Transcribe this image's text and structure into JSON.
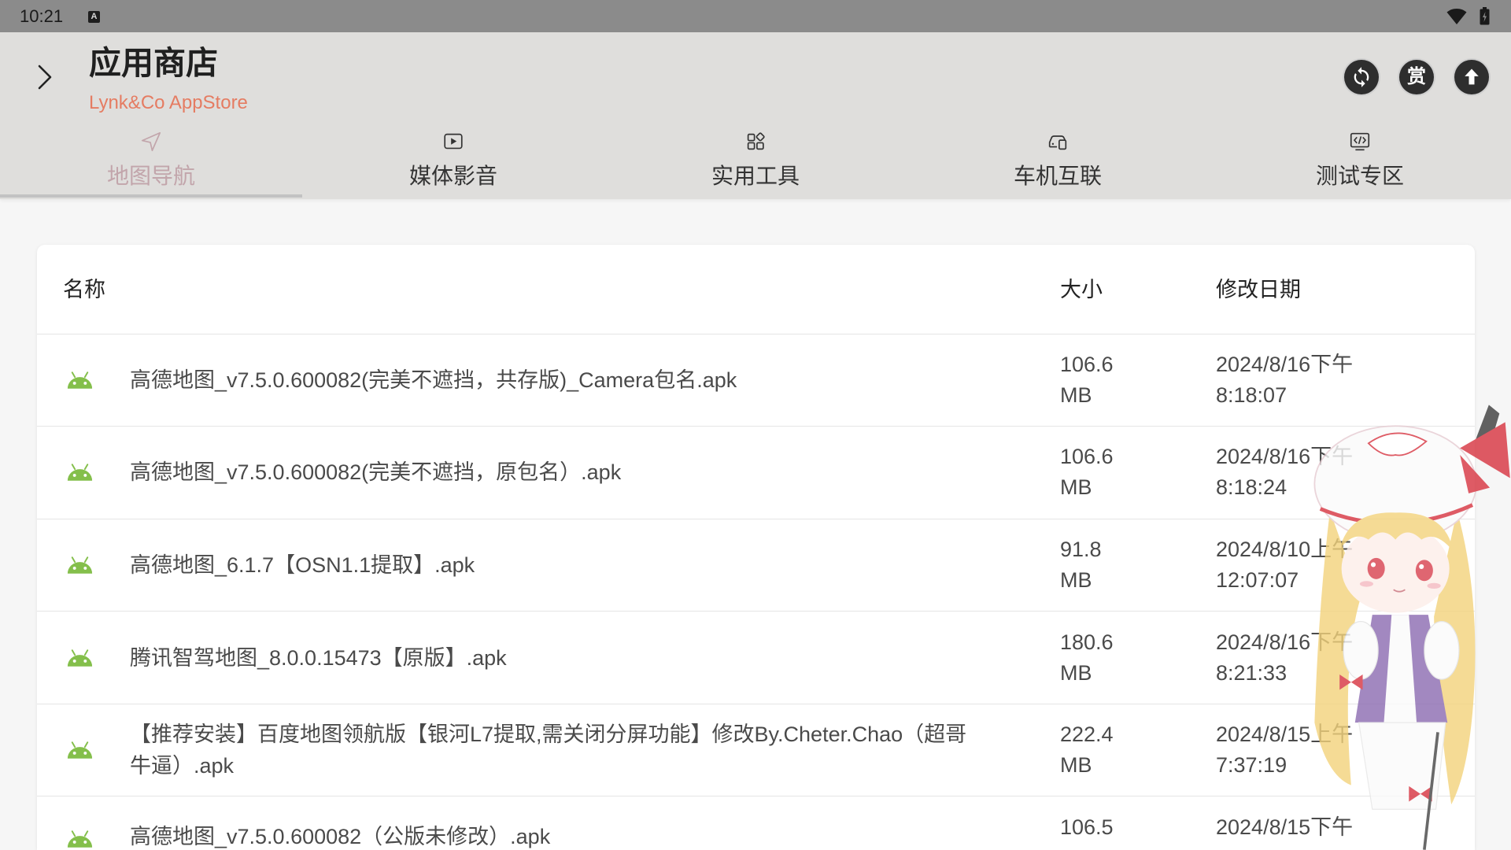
{
  "status_bar": {
    "time": "10:21",
    "indicator_label": "A",
    "icons": [
      "notification-a-icon",
      "wifi-icon",
      "battery-icon"
    ]
  },
  "header": {
    "back_icon": "chevron-right-icon",
    "title": "应用商店",
    "subtitle": "Lynk&Co AppStore",
    "actions": [
      {
        "icon": "refresh-icon"
      },
      {
        "icon": "reward-icon",
        "label": "赏"
      },
      {
        "icon": "upload-icon"
      }
    ]
  },
  "tabs": [
    {
      "label": "地图导航",
      "icon": "navigation-icon",
      "selected": true
    },
    {
      "label": "媒体影音",
      "icon": "play-icon",
      "selected": false
    },
    {
      "label": "实用工具",
      "icon": "grid-icon",
      "selected": false
    },
    {
      "label": "车机互联",
      "icon": "car-connect-icon",
      "selected": false
    },
    {
      "label": "测试专区",
      "icon": "code-icon",
      "selected": false
    }
  ],
  "files": {
    "columns": {
      "name": "名称",
      "size": "大小",
      "modified": "修改日期"
    },
    "rows": [
      {
        "icon": "android-icon",
        "name": "高德地图_v7.5.0.600082(完美不遮挡，共存版)_Camera包名.apk",
        "size": "106.6",
        "unit": "MB",
        "date": "2024/8/16下午",
        "time": "8:18:07"
      },
      {
        "icon": "android-icon",
        "name": "高德地图_v7.5.0.600082(完美不遮挡，原包名）.apk",
        "size": "106.6",
        "unit": "MB",
        "date": "2024/8/16下午",
        "time": "8:18:24"
      },
      {
        "icon": "android-icon",
        "name": "高德地图_6.1.7【OSN1.1提取】.apk",
        "size": "91.8",
        "unit": "MB",
        "date": "2024/8/10上午",
        "time": "12:07:07"
      },
      {
        "icon": "android-icon",
        "name": "腾讯智驾地图_8.0.0.15473【原版】.apk",
        "size": "180.6",
        "unit": "MB",
        "date": "2024/8/16下午",
        "time": "8:21:33"
      },
      {
        "icon": "android-icon",
        "name": "【推荐安装】百度地图领航版【银河L7提取,需关闭分屏功能】修改By.Cheter.Chao（超哥牛逼）.apk",
        "size": "222.4",
        "unit": "MB",
        "date": "2024/8/15上午",
        "time": "7:37:19"
      },
      {
        "icon": "android-icon",
        "name": "高德地图_v7.5.0.600082（公版未修改）.apk",
        "size": "106.5",
        "date": "2024/8/15下午"
      }
    ]
  },
  "colors": {
    "accent": "#e57c62",
    "tab_selected": "#c2a5ab",
    "android_green": "#84bf4b",
    "action_button": "#2e2e2e"
  }
}
